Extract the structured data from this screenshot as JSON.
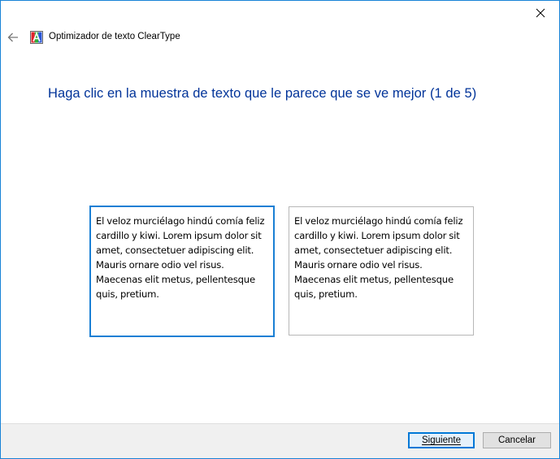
{
  "window": {
    "title": "Optimizador de texto ClearType",
    "icons": {
      "close": "close-icon",
      "back": "back-arrow-icon",
      "app": "cleartype-app-icon"
    }
  },
  "main": {
    "instruction": "Haga clic en la muestra de texto que le parece que se ve mejor (1 de 5)",
    "samples": [
      {
        "text": "El veloz murciélago hindú comía feliz cardillo y kiwi. Lorem ipsum dolor sit amet, consectetuer adipiscing elit. Mauris ornare odio vel risus. Maecenas elit metus, pellentesque quis, pretium.",
        "selected": true
      },
      {
        "text": "El veloz murciélago hindú comía feliz cardillo y kiwi. Lorem ipsum dolor sit amet, consectetuer adipiscing elit. Mauris ornare odio vel risus. Maecenas elit metus, pellentesque quis, pretium.",
        "selected": false
      }
    ]
  },
  "footer": {
    "next_label": "Siguiente",
    "cancel_label": "Cancelar"
  },
  "colors": {
    "accent": "#0078d7",
    "instruction_text": "#003399",
    "footer_bg": "#f0f0f0",
    "window_border": "#1883d7"
  }
}
